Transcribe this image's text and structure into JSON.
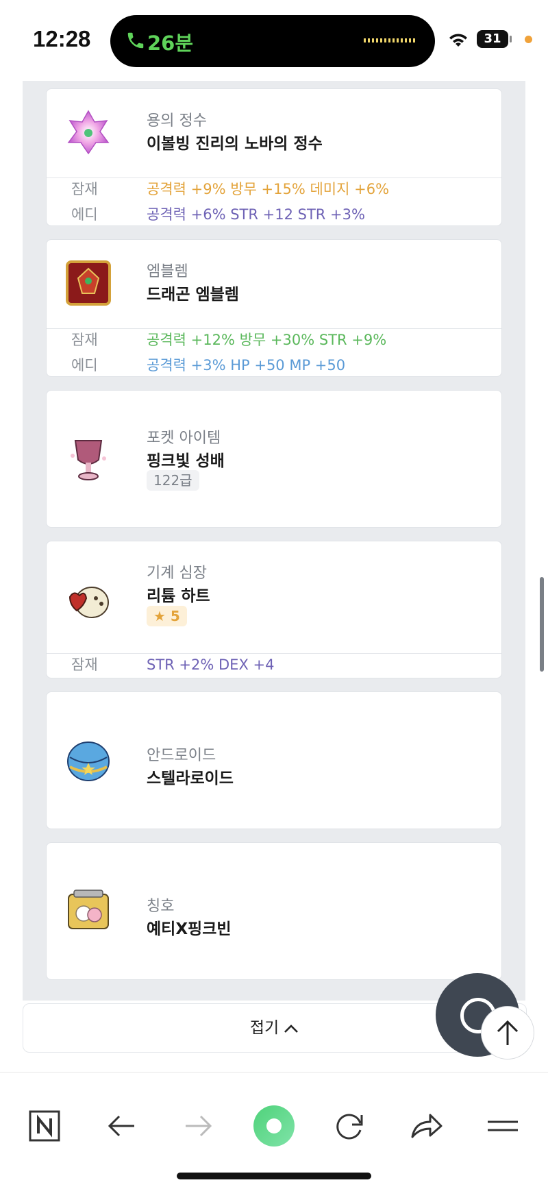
{
  "status": {
    "time": "12:28",
    "call": "26분",
    "battery": "31"
  },
  "items": [
    {
      "category": "용의 정수",
      "name": "이볼빙 진리의 노바의 정수",
      "options": [
        {
          "label": "잠재",
          "value": "공격력 +9%  방무 +15%  데미지 +6%",
          "color": "#e3a33a"
        },
        {
          "label": "에디",
          "value": "공격력 +6%  STR +12  STR +3%",
          "color": "#6e62b5"
        }
      ]
    },
    {
      "category": "엠블렘",
      "name": "드래곤 엠블렘",
      "options": [
        {
          "label": "잠재",
          "value": "공격력 +12%  방무 +30%  STR +9%",
          "color": "#5bb85c"
        },
        {
          "label": "에디",
          "value": "공격력 +3%  HP +50  MP +50",
          "color": "#5a9ad6"
        }
      ]
    },
    {
      "category": "포켓 아이템",
      "name": "핑크빛 성배",
      "badge": "122급"
    },
    {
      "category": "기계 심장",
      "name": "리튬 하트",
      "badge_star": "★ 5",
      "options": [
        {
          "label": "잠재",
          "value": "STR +2%  DEX +4",
          "color": "#6e62b5"
        }
      ]
    },
    {
      "category": "안드로이드",
      "name": "스텔라로이드"
    },
    {
      "category": "칭호",
      "name": "예티X핑크빈"
    }
  ],
  "fold": {
    "label": "접기"
  },
  "icons": [
    "phone-icon",
    "wifi-icon",
    "battery-icon",
    "chat-icon",
    "arrow-up-icon",
    "naver-icon",
    "back-arrow-icon",
    "forward-arrow-icon",
    "green-home-icon",
    "refresh-icon",
    "share-icon",
    "menu-icon"
  ]
}
